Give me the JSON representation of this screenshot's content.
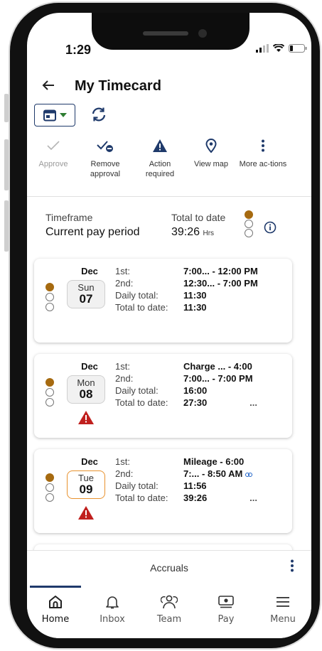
{
  "status_bar": {
    "time": "1:29"
  },
  "header": {
    "title": "My Timecard"
  },
  "actions": [
    {
      "label": "Approve",
      "icon": "check-icon",
      "enabled": false
    },
    {
      "label": "Remove approval",
      "icon": "remove-approval-icon",
      "enabled": true
    },
    {
      "label": "Action required",
      "icon": "warning-icon",
      "enabled": true
    },
    {
      "label": "View map",
      "icon": "map-pin-icon",
      "enabled": true
    },
    {
      "label": "More ac-tions",
      "icon": "more-vertical-icon",
      "enabled": true
    }
  ],
  "summary": {
    "timeframe_label": "Timeframe",
    "timeframe_value": "Current pay period",
    "total_label": "Total to date",
    "total_value": "39:26",
    "total_unit": "Hrs"
  },
  "days": [
    {
      "month": "Dec",
      "dow": "Sun",
      "day": "07",
      "today": false,
      "alert": false,
      "rows": [
        {
          "key": "1st:",
          "value": "7:00... - 12:00 PM"
        },
        {
          "key": "2nd:",
          "value": "12:30... - 7:00 PM"
        },
        {
          "key": "Daily total:",
          "value": "11:30"
        },
        {
          "key": "Total to date:",
          "value": "11:30"
        }
      ],
      "more": ""
    },
    {
      "month": "Dec",
      "dow": "Mon",
      "day": "08",
      "today": false,
      "alert": true,
      "rows": [
        {
          "key": "1st:",
          "value": "Charge ... - 4:00"
        },
        {
          "key": "2nd:",
          "value": "7:00... - 7:00 PM"
        },
        {
          "key": "Daily total:",
          "value": "16:00"
        },
        {
          "key": "Total to date:",
          "value": "27:30"
        }
      ],
      "more": "..."
    },
    {
      "month": "Dec",
      "dow": "Tue",
      "day": "09",
      "today": true,
      "alert": true,
      "rows": [
        {
          "key": "1st:",
          "value": "Mileage - 6:00"
        },
        {
          "key": "2nd:",
          "value": "7:... - 8:50 AM"
        },
        {
          "key": "Daily total:",
          "value": "11:56"
        },
        {
          "key": "Total to date:",
          "value": "39:26"
        }
      ],
      "more": "..."
    }
  ],
  "accruals": {
    "label": "Accruals"
  },
  "nav": [
    {
      "label": "Home",
      "icon": "home-icon",
      "active": true
    },
    {
      "label": "Inbox",
      "icon": "bell-icon",
      "active": false
    },
    {
      "label": "Team",
      "icon": "team-icon",
      "active": false
    },
    {
      "label": "Pay",
      "icon": "pay-icon",
      "active": false
    },
    {
      "label": "Menu",
      "icon": "menu-icon",
      "active": false
    }
  ],
  "colors": {
    "accent": "#1f3a6b",
    "alert": "#c0201e",
    "today": "#e8912d",
    "dot": "#a66a10",
    "link": "#1f63c9"
  }
}
